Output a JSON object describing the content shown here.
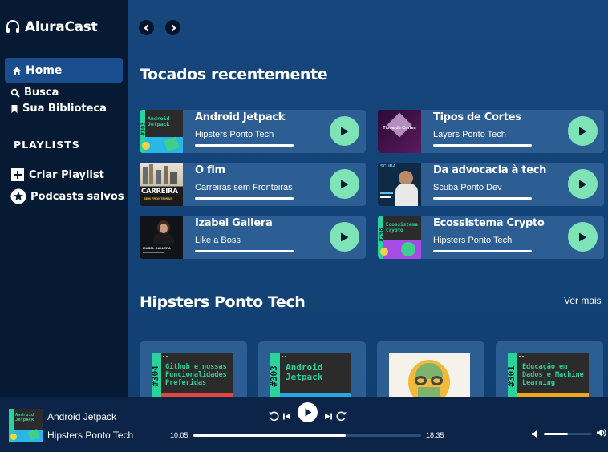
{
  "app": {
    "name": "AluraCast"
  },
  "sidebar": {
    "items": [
      {
        "label": "Home",
        "icon": "home-icon",
        "active": true
      },
      {
        "label": "Busca",
        "icon": "search-icon"
      },
      {
        "label": "Sua Biblioteca",
        "icon": "bookmark-icon"
      }
    ],
    "playlists_heading": "PLAYLISTS",
    "playlist_actions": [
      {
        "label": "Criar Playlist",
        "icon": "plus-icon"
      },
      {
        "label": "Podcasts salvos",
        "icon": "star-icon"
      }
    ]
  },
  "recent": {
    "heading": "Tocados recentemente",
    "items": [
      {
        "title": "Android Jetpack",
        "podcast": "Hipsters Ponto Tech",
        "thumb_text": "Android Jetpack",
        "episode": "#303"
      },
      {
        "title": "Tipos de Cortes",
        "podcast": "Layers Ponto Tech",
        "thumb_text": "Tipos de Cortes"
      },
      {
        "title": "O fim",
        "podcast": "Carreiras sem Fronteiras",
        "thumb_text": "CARREIRA",
        "thumb_sub": "SEM FRONTEIRAS"
      },
      {
        "title": "Da advocacia à tech",
        "podcast": "Scuba Ponto Dev",
        "thumb_text": "SCUBA"
      },
      {
        "title": "Izabel Gallera",
        "podcast": "Like a Boss",
        "thumb_text": "IZABEL GALLERA"
      },
      {
        "title": "Ecossistema Crypto",
        "podcast": "Hipsters Ponto Tech",
        "thumb_text": "Ecossistema Crypto",
        "episode": "#298"
      }
    ]
  },
  "hipsters": {
    "heading": "Hipsters Ponto Tech",
    "see_more": "Ver mais",
    "episodes": [
      {
        "number": "#304",
        "title": "Github e nossas Funcionalidades Preferidas",
        "stripe": "#e0473f"
      },
      {
        "number": "#303",
        "title": "Android Jetpack",
        "stripe": "#2aa7e0"
      },
      {
        "number": "",
        "title": "",
        "stripe": ""
      },
      {
        "number": "#301",
        "title": "Educação em Dados e Machine Learning",
        "stripe": "#f2a51b"
      }
    ]
  },
  "player": {
    "title": "Android Jetpack",
    "podcast": "Hipsters Ponto Tech",
    "elapsed": "10:05",
    "total": "18:35",
    "progress": 0.67,
    "volume": 0.5
  },
  "colors": {
    "sidebar_bg": "#071a34",
    "main_bg": "#16467d",
    "card_bg": "#2c5e94",
    "accent_green": "#7fe3b8",
    "player_bg": "#0b2447"
  }
}
